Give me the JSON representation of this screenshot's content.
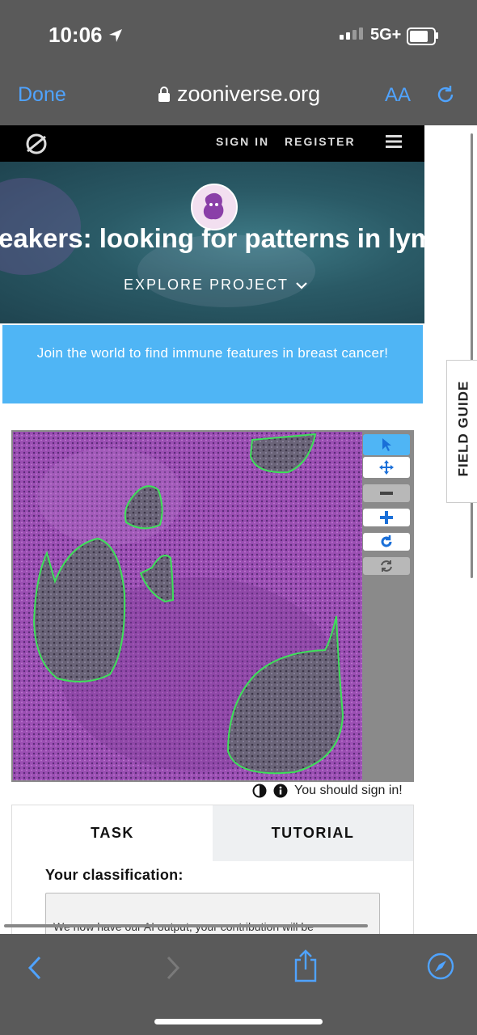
{
  "status": {
    "time": "10:06",
    "network": "5G+"
  },
  "browser": {
    "done_label": "Done",
    "url": "zooniverse.org",
    "text_size_label": "AA"
  },
  "nav": {
    "sign_in": "SIGN IN",
    "register": "REGISTER"
  },
  "hero": {
    "title": "eakers: looking for patterns in lymph",
    "explore": "EXPLORE PROJECT"
  },
  "banner": {
    "text": "Join the world to find immune features in breast cancer!"
  },
  "field_guide": "FIELD GUIDE",
  "subject": {
    "sign_in_notice": "You should sign in!"
  },
  "tabs": {
    "task": "TASK",
    "tutorial": "TUTORIAL"
  },
  "task": {
    "heading": "Your classification:",
    "message": "We now have our AI output, your contribution will be"
  },
  "colors": {
    "accent": "#4fa3ff",
    "banner": "#4fb5f5",
    "outline": "#3ee05a",
    "tissue": "#9b4fb3"
  },
  "icons": [
    "location-arrow-icon",
    "lock-icon",
    "refresh-icon",
    "zooniverse-logo-icon",
    "hamburger-icon",
    "pointer-icon",
    "move-icon",
    "zoom-out-icon",
    "zoom-in-icon",
    "rotate-icon",
    "reset-icon",
    "contrast-icon",
    "info-icon",
    "back-icon",
    "forward-icon",
    "share-icon",
    "compass-icon"
  ]
}
